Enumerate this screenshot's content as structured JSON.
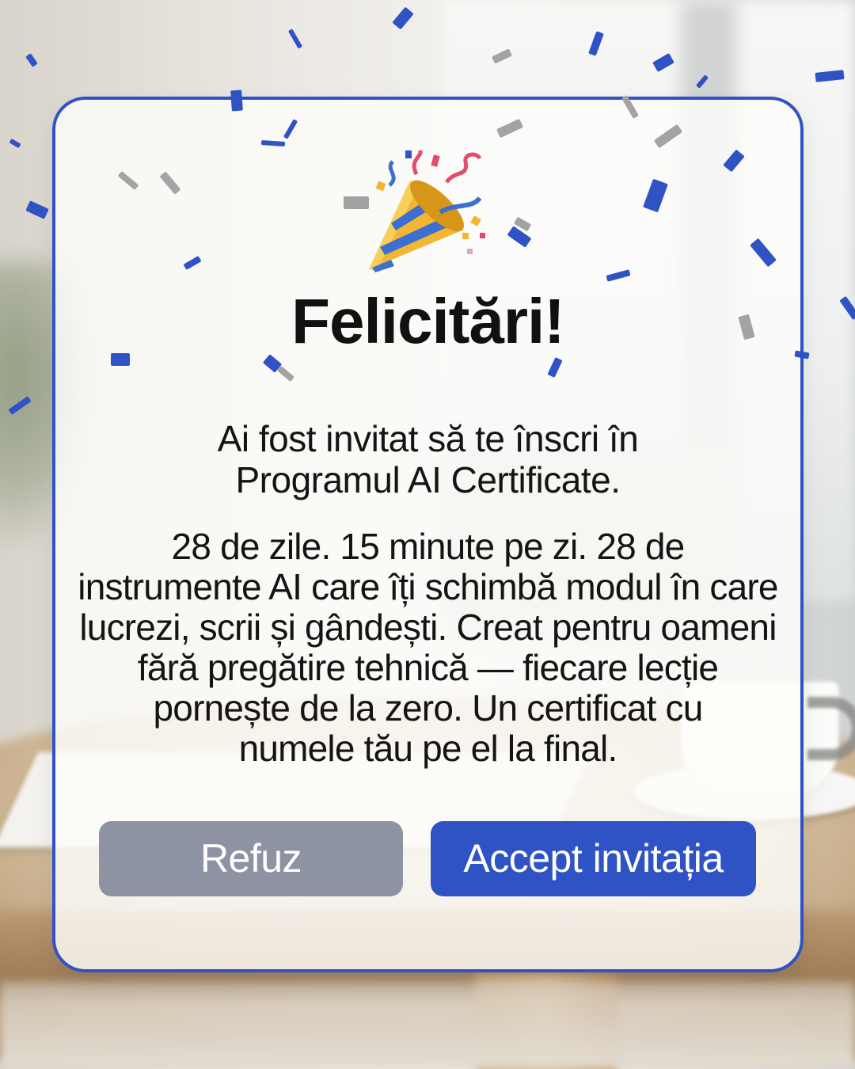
{
  "dialog": {
    "title": "Felicitări!",
    "subtitle_lines": [
      "Ai fost invitat să te înscri în",
      "Programul AI Certificate."
    ],
    "body_lines": [
      "28 de zile. 15 minute pe zi. 28 de",
      "instrumente AI care îți schimbă modul în care",
      "lucrezi, scrii și gândești. Creat pentru oameni",
      "fără pregătire tehnică — fiecare lecție",
      "pornește de la zero. Un certificat cu",
      "numele tău pe el la final."
    ],
    "decline_label": "Refuz",
    "accept_label": "Accept invitația",
    "icon": "party-popper-icon"
  },
  "colors": {
    "accent": "#2f52c4",
    "decline_button": "#8d93a3",
    "confetti_blue": "#2f52c4",
    "confetti_gray": "#a3a3a3"
  }
}
